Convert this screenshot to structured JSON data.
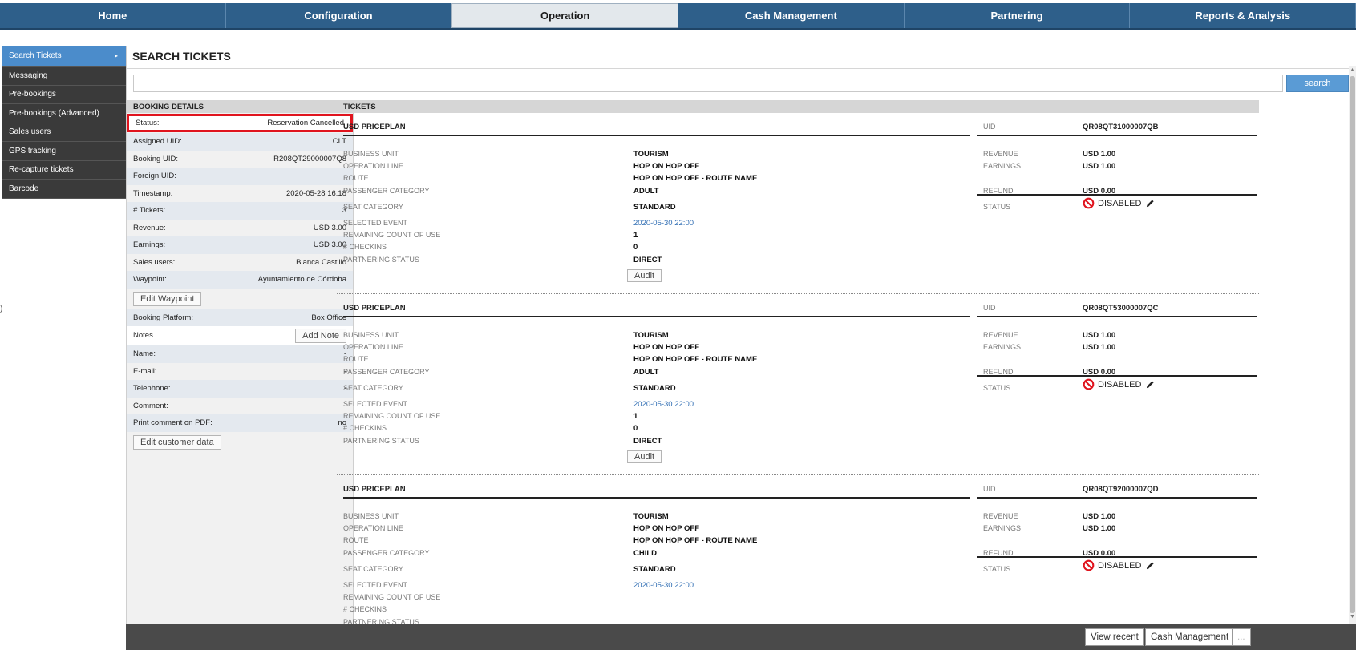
{
  "nav": {
    "tabs": [
      {
        "label": "Home"
      },
      {
        "label": "Configuration"
      },
      {
        "label": "Operation"
      },
      {
        "label": "Cash Management"
      },
      {
        "label": "Partnering"
      },
      {
        "label": "Reports & Analysis"
      }
    ],
    "active": "Operation"
  },
  "sidebar": {
    "items": [
      {
        "label": "Search Tickets"
      },
      {
        "label": "Messaging"
      },
      {
        "label": "Pre-bookings"
      },
      {
        "label": "Pre-bookings (Advanced)"
      },
      {
        "label": "Sales users"
      },
      {
        "label": "GPS tracking"
      },
      {
        "label": "Re-capture tickets"
      },
      {
        "label": "Barcode"
      }
    ],
    "active_arrow": "▸"
  },
  "page": {
    "title": "SEARCH TICKETS",
    "search_button": "search",
    "search_value": "",
    "left_marker": ")"
  },
  "booking": {
    "header": "BOOKING DETAILS",
    "rows": [
      {
        "label": "Status:",
        "value": "Reservation Cancelled"
      },
      {
        "label": "Assigned UID:",
        "value": "CLT"
      },
      {
        "label": "Booking UID:",
        "value": "R208QT29000007Q8"
      },
      {
        "label": "Foreign UID:",
        "value": "-"
      },
      {
        "label": "Timestamp:",
        "value": "2020-05-28 16:18"
      },
      {
        "label": "# Tickets:",
        "value": "3"
      },
      {
        "label": "Revenue:",
        "value": "USD 3.00"
      },
      {
        "label": "Earnings:",
        "value": "USD 3.00"
      },
      {
        "label": "Sales users:",
        "value": "Blanca Castillo"
      },
      {
        "label": "Waypoint:",
        "value": "Ayuntamiento de Córdoba"
      }
    ],
    "edit_waypoint": "Edit Waypoint",
    "platform": {
      "label": "Booking Platform:",
      "value": "Box Office"
    },
    "notes": {
      "label": "Notes",
      "button": "Add Note"
    },
    "customer_rows": [
      {
        "label": "Name:",
        "value": "-"
      },
      {
        "label": "E-mail:",
        "value": "-"
      },
      {
        "label": "Telephone:",
        "value": "-"
      },
      {
        "label": "Comment:",
        "value": "-"
      },
      {
        "label": "Print comment on PDF:",
        "value": "no"
      }
    ],
    "edit_customer": "Edit customer data"
  },
  "tickets": {
    "header": "TICKETS",
    "labels": {
      "business_unit": "BUSINESS UNIT",
      "operation_line": "OPERATION LINE",
      "route": "ROUTE",
      "passenger_category": "PASSENGER CATEGORY",
      "seat_category": "SEAT CATEGORY",
      "selected_event": "SELECTED EVENT",
      "remaining": "REMAINING COUNT OF USE",
      "checkins": "# CHECKINS",
      "partnering_status": "PARTNERING STATUS",
      "uid": "UID",
      "revenue": "REVENUE",
      "earnings": "EARNINGS",
      "refund": "REFUND",
      "status": "STATUS",
      "audit": "Audit"
    },
    "items": [
      {
        "priceplan": "USD PRICEPLAN",
        "uid": "QR08QT31000007QB",
        "business_unit": "TOURISM",
        "operation_line": "HOP ON HOP OFF",
        "route": "HOP ON HOP OFF - ROUTE NAME",
        "passenger_category": "ADULT",
        "seat_category": "STANDARD",
        "selected_event": "2020-05-30 22:00",
        "remaining": "1",
        "checkins": "0",
        "partnering_status": "DIRECT",
        "revenue": "USD 1.00",
        "earnings": "USD 1.00",
        "refund": "USD 0.00",
        "status": "DISABLED"
      },
      {
        "priceplan": "USD PRICEPLAN",
        "uid": "QR08QT53000007QC",
        "business_unit": "TOURISM",
        "operation_line": "HOP ON HOP OFF",
        "route": "HOP ON HOP OFF - ROUTE NAME",
        "passenger_category": "ADULT",
        "seat_category": "STANDARD",
        "selected_event": "2020-05-30 22:00",
        "remaining": "1",
        "checkins": "0",
        "partnering_status": "DIRECT",
        "revenue": "USD 1.00",
        "earnings": "USD 1.00",
        "refund": "USD 0.00",
        "status": "DISABLED"
      },
      {
        "priceplan": "USD PRICEPLAN",
        "uid": "QR08QT92000007QD",
        "business_unit": "TOURISM",
        "operation_line": "HOP ON HOP OFF",
        "route": "HOP ON HOP OFF - ROUTE NAME",
        "passenger_category": "CHILD",
        "seat_category": "STANDARD",
        "selected_event": "2020-05-30 22:00",
        "remaining": "",
        "checkins": "",
        "partnering_status": "",
        "revenue": "USD 1.00",
        "earnings": "USD 1.00",
        "refund": "USD 0.00",
        "status": "DISABLED"
      }
    ]
  },
  "footer": {
    "buttons": [
      {
        "label": "View recent"
      },
      {
        "label": "Cash Management"
      },
      {
        "label": "..."
      }
    ]
  },
  "colors": {
    "nav_bg": "#2e5f8a",
    "sidebar_active": "#4b8ccb",
    "highlight": "#e0141e",
    "status_icon": "#e0141e"
  }
}
